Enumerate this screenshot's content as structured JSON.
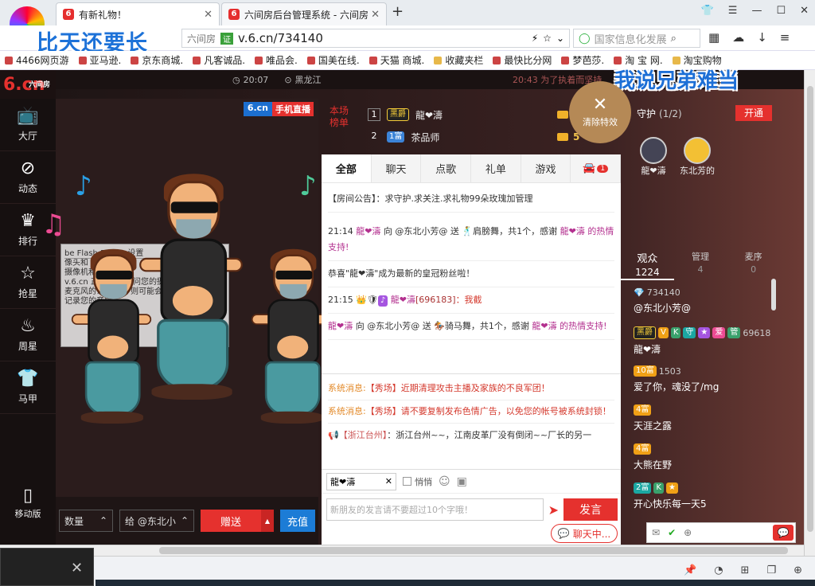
{
  "browser": {
    "tab1": "有新礼物！",
    "tab2": "六间房后台管理系统 - 六间房",
    "address_site": "六间房",
    "address_cert": "证",
    "url": "v.6.cn/734140",
    "search_placeholder": "国家信息化发展",
    "bookmarks": [
      "4466网页游",
      "亚马逊.",
      "京东商城.",
      "凡客诚品.",
      "唯品会.",
      "国美在线.",
      "天猫 商城.",
      "收藏夹栏",
      "最快比分网",
      "梦芭莎.",
      "淘 宝 网.",
      "淘宝购物"
    ]
  },
  "overlay": {
    "top_left": "比天还要长",
    "top_right": "我说兄弟难当"
  },
  "nav": {
    "brand": "6.cn",
    "brand_sub": "六间房",
    "items": [
      "大厅",
      "动态",
      "排行",
      "抢星",
      "周星",
      "马甲"
    ],
    "mobile": "移动版"
  },
  "strip": {
    "time": "20:07",
    "region": "黑龙江",
    "announce": "20:43 为了执着而坚持"
  },
  "video": {
    "badge_a": "6.cn",
    "badge_b": "手机直播",
    "flash_title": "be Flash Player 设置",
    "flash_body": "像头和\n摄像机和麦克风\nv.6.cn 正在 请求访问您的摄像头和\n麦克风的访问权限 则可能会\n记录您的音频"
  },
  "gift": {
    "qty_placeholder": "数量",
    "to_user": "给 @东北小",
    "send": "赠送",
    "recharge": "充值"
  },
  "rank": {
    "label": "本场\n榜单",
    "rows": [
      {
        "n": "1",
        "badge": "黑爵",
        "name": "龍❤濤",
        "coins": "7000"
      },
      {
        "n": "2",
        "badge": "1富",
        "name": "茶品师",
        "coins": "5"
      }
    ]
  },
  "clear_fx": "清除特效",
  "chat": {
    "tabs": [
      "全部",
      "聊天",
      "点歌",
      "礼单",
      "游戏",
      ""
    ],
    "car_count": "1",
    "announce_label": "【房间公告】",
    "announce": "：求守护.求关注.求礼物99朵玫瑰加管理",
    "m1_time": "21:14",
    "m1_from": "龍❤濤",
    "m1_mid": " 向 @东北小芳@ 送 ",
    "m1_gift": "肩膀舞，共1个，感谢 ",
    "m1_thanks": "龍❤濤 的热情支持!",
    "m2": "恭喜\"龍❤濤\"成为最新的皇冠粉丝啦！",
    "m3_time": "21:15",
    "m3_name": "龍❤濤",
    "m3_uid": "[696183]",
    "m3_text": "：我截",
    "m4_from": "龍❤濤",
    "m4_mid": " 向 @东北小芳@ 送 ",
    "m4_gift": "骑马舞，共1个，感谢 ",
    "m4_thanks": "龍❤濤 的热情支持!",
    "sys_label": "系统消息:",
    "sys1": "【秀场】近期清理攻击主播及家族的不良军团！",
    "sys2": "【秀场】请不要复制发布色情广告，以免您的帐号被系统封锁！",
    "region_label": "【浙江台州】",
    "region_text": "：浙江台州~~，江南皮革厂没有倒闭~~厂长的另一",
    "to": "龍❤濤",
    "whisper": "悄悄",
    "input_placeholder": "新朋友的发言请不要超过10个字哦！",
    "send": "发言"
  },
  "guard": {
    "label": "守护",
    "count": "(1/2)",
    "open": "开通",
    "avatars": [
      "龍❤濤",
      "东北芳的"
    ]
  },
  "utabs": [
    {
      "label": "观众",
      "count": "1224"
    },
    {
      "label": "管理",
      "count": "4"
    },
    {
      "label": "麦序",
      "count": "0"
    }
  ],
  "users": [
    {
      "meta": "734140",
      "badges": [],
      "name": "@东北小芳@"
    },
    {
      "meta": "69618",
      "badges": [
        "黑爵",
        "V",
        "K",
        "守",
        "★",
        "爱",
        "管"
      ],
      "name": "龍❤濤"
    },
    {
      "meta": "1503",
      "badges": [
        "10富"
      ],
      "name": "爱了你，魂没了/mg"
    },
    {
      "meta": "",
      "badges": [
        "4富"
      ],
      "name": "天涯之露"
    },
    {
      "meta": "",
      "badges": [
        "4富"
      ],
      "name": "大熊在野"
    },
    {
      "meta": "",
      "badges": [
        "2富",
        "K",
        "★"
      ],
      "name": "开心快乐每一天5"
    }
  ],
  "chat_pop": "聊天中..."
}
